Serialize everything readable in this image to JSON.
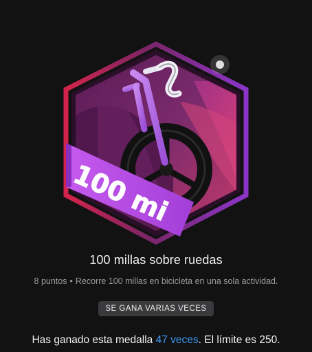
{
  "badge": {
    "label": "100 mi",
    "icon": "bicycle-icon",
    "colors": {
      "frame_outer": "#8a2a6a",
      "accent_red": "#e0304a",
      "accent_purple": "#9a3fd0",
      "ribbon": "#b84fe6",
      "tire": "#1a1a1a"
    }
  },
  "title": "100 millas sobre ruedas",
  "description": {
    "points": "8 puntos",
    "separator": "•",
    "text": "Recorre 100 millas en bicicleta en una sola actividad."
  },
  "chip": "SE GANA VARIAS VECES",
  "earned": {
    "prefix": "Has ganado esta medalla ",
    "count_link": "47 veces",
    "suffix": ". El límite es 250."
  }
}
